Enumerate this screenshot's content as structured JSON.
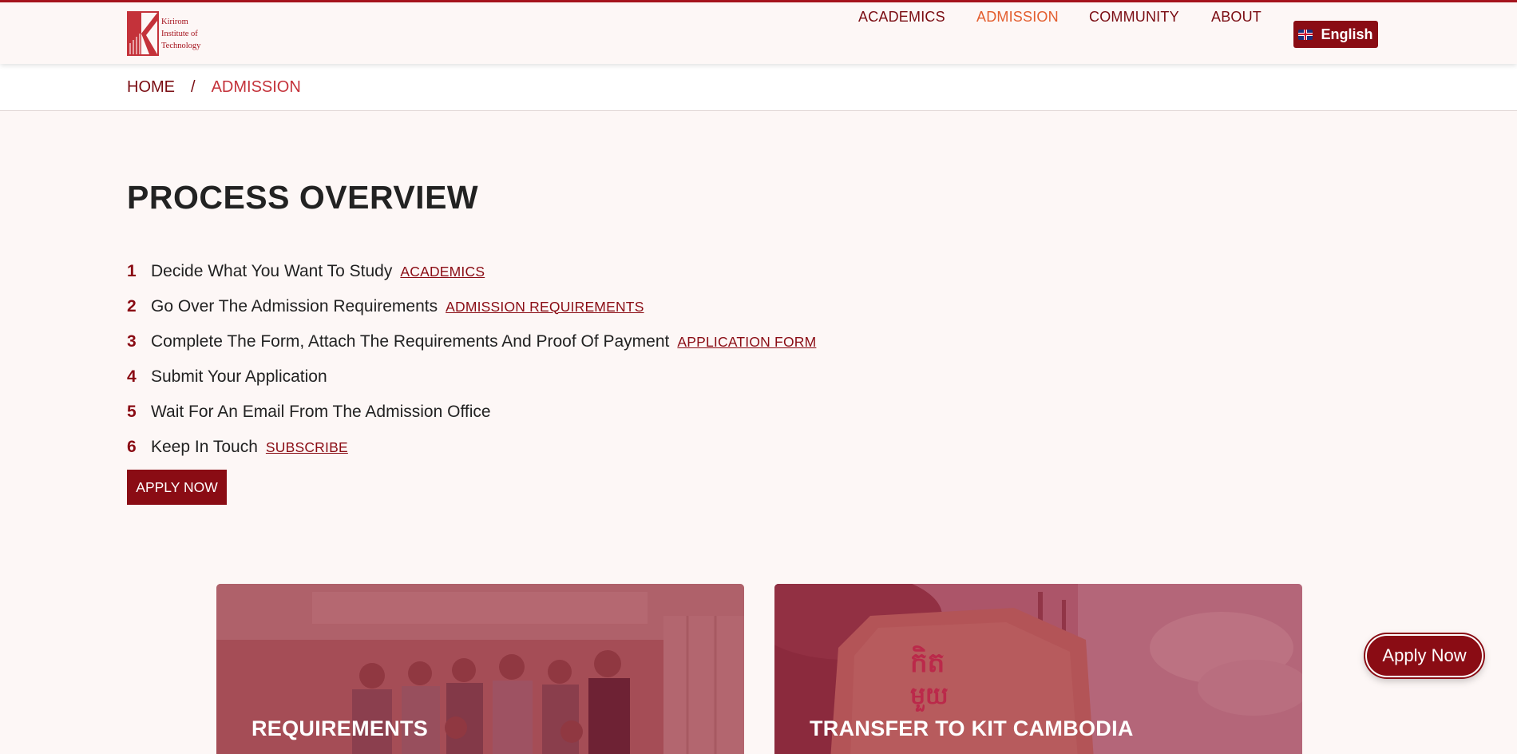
{
  "header": {
    "logo_lines": [
      "Kirirom",
      "Institute of",
      "Technology"
    ],
    "nav": [
      {
        "label": "ACADEMICS",
        "active": false
      },
      {
        "label": "ADMISSION",
        "active": true
      },
      {
        "label": "COMMUNITY",
        "active": false
      },
      {
        "label": "ABOUT",
        "active": false
      }
    ],
    "language_button": "English",
    "language_icon": "uk-flag-icon"
  },
  "breadcrumb": {
    "home": "HOME",
    "separator": "/",
    "current": "ADMISSION"
  },
  "main": {
    "title": "PROCESS OVERVIEW",
    "steps": [
      {
        "num": "1",
        "text": "Decide What You Want To Study",
        "link": "ACADEMICS"
      },
      {
        "num": "2",
        "text": "Go Over The Admission Requirements",
        "link": "ADMISSION REQUIREMENTS"
      },
      {
        "num": "3",
        "text": "Complete The Form, Attach The Requirements And Proof Of Payment",
        "link": "APPLICATION FORM"
      },
      {
        "num": "4",
        "text": "Submit Your Application",
        "link": ""
      },
      {
        "num": "5",
        "text": "Wait For An Email From The Admission Office",
        "link": ""
      },
      {
        "num": "6",
        "text": "Keep In Touch",
        "link": "SUBSCRIBE"
      }
    ],
    "apply_button": "APPLY NOW"
  },
  "cards": [
    {
      "title": "REQUIREMENTS"
    },
    {
      "title": "TRANSFER TO KIT CAMBODIA"
    }
  ],
  "floating_apply": "Apply Now",
  "colors": {
    "brand": "#8a0c14",
    "active_nav": "#e35d2e",
    "background": "#fdf7f6"
  }
}
